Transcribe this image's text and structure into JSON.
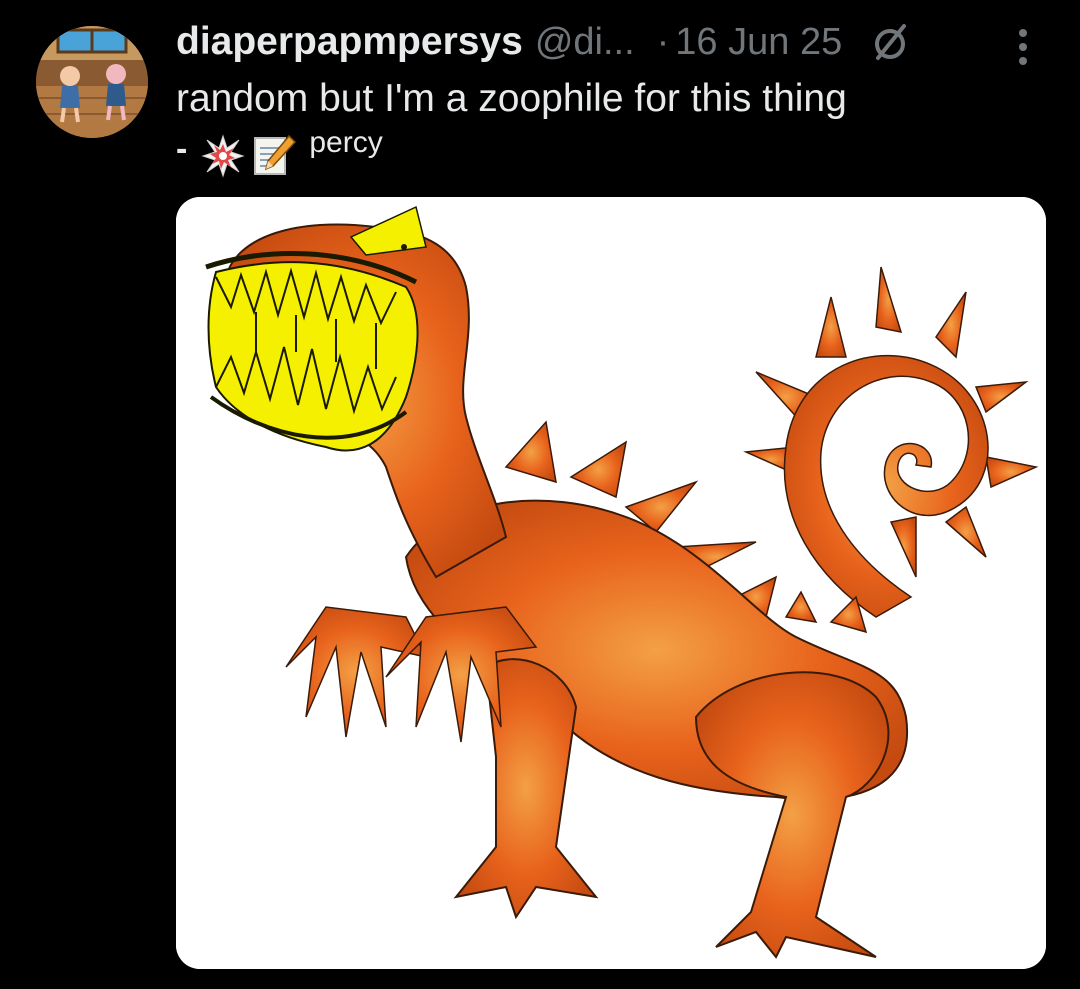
{
  "post": {
    "author": {
      "display_name": "diaperpapmpersys",
      "handle": "@di...",
      "avatar_icon": "avatar-image"
    },
    "separator": "·",
    "date": "16 Jun 25",
    "text": "random but I'm a zoophile for this thing",
    "signature": {
      "dash": "-",
      "emojis": [
        "collision-emoji",
        "memo-emoji"
      ],
      "name": "percy"
    },
    "grok_icon": "grok-icon",
    "more_icon": "more-options-icon",
    "media": {
      "type": "image",
      "description_icon": "orange-creature-image"
    }
  },
  "colors": {
    "background": "#000000",
    "primary_text": "#e7e9ea",
    "secondary_text": "#71767b",
    "media_background": "#ffffff",
    "creature_orange": "#e8631c",
    "teeth_yellow": "#f5f000"
  }
}
